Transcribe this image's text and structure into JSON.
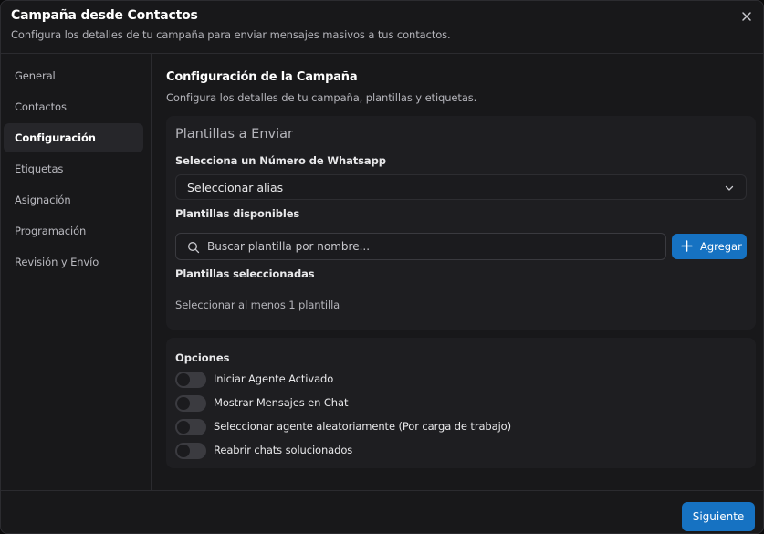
{
  "dialog": {
    "title": "Campaña desde Contactos",
    "subtitle": "Configura los detalles de tu campaña para enviar mensajes masivos a tus contactos.",
    "close_icon": "close-icon"
  },
  "sidebar": {
    "items": [
      {
        "label": "General",
        "active": false
      },
      {
        "label": "Contactos",
        "active": false
      },
      {
        "label": "Configuración",
        "active": true
      },
      {
        "label": "Etiquetas",
        "active": false
      },
      {
        "label": "Asignación",
        "active": false
      },
      {
        "label": "Programación",
        "active": false
      },
      {
        "label": "Revisión y Envío",
        "active": false
      }
    ]
  },
  "main": {
    "title": "Configuración de la Campaña",
    "description": "Configura los detalles de tu campaña, plantillas y etiquetas.",
    "templates_card": {
      "title": "Plantillas a Enviar",
      "whatsapp_label": "Selecciona un Número de Whatsapp",
      "alias_select_value": "Seleccionar alias",
      "available_label": "Plantillas disponibles",
      "search_placeholder": "Buscar plantilla por nombre...",
      "add_button": "Agregar",
      "selected_label": "Plantillas seleccionadas",
      "selected_hint": "Seleccionar al menos 1 plantilla"
    },
    "options_card": {
      "title": "Opciones",
      "options": [
        {
          "label": "Iniciar Agente Activado",
          "enabled": false
        },
        {
          "label": "Mostrar Mensajes en Chat",
          "enabled": false
        },
        {
          "label": "Seleccionar agente aleatoriamente (Por carga de trabajo)",
          "enabled": false
        },
        {
          "label": "Reabrir chats solucionados",
          "enabled": false
        }
      ]
    }
  },
  "footer": {
    "next_button": "Siguiente"
  },
  "colors": {
    "accent": "#1672c2",
    "background": "#18181a",
    "card": "#1e1e21"
  }
}
